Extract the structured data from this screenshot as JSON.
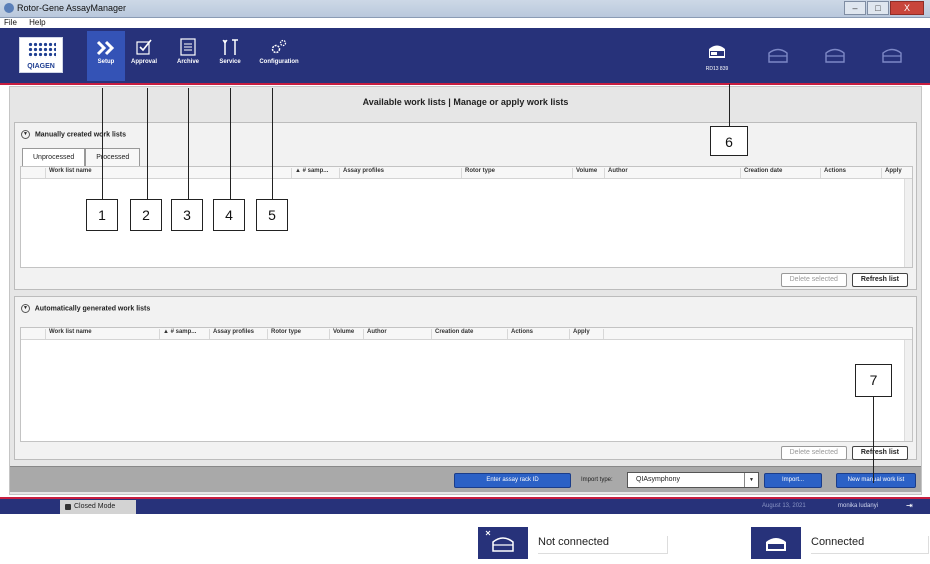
{
  "window": {
    "title": "Rotor-Gene AssayManager",
    "min": "–",
    "max": "□",
    "close": "X"
  },
  "menu": [
    "File",
    "Help"
  ],
  "logo_text": "QIAGEN",
  "nav": [
    {
      "label": "Setup",
      "icon": "setup-icon"
    },
    {
      "label": "Approval",
      "icon": "approval-icon"
    },
    {
      "label": "Archive",
      "icon": "archive-icon"
    },
    {
      "label": "Service",
      "icon": "service-icon"
    },
    {
      "label": "Configuration",
      "icon": "configuration-icon"
    }
  ],
  "instruments": [
    {
      "label": "RD13 839",
      "icon": "cycler-icon"
    }
  ],
  "main_title": "Available work lists | Manage or apply work lists",
  "panel1": {
    "title": "Manually created work lists",
    "tabs": [
      "Unprocessed",
      "Processed"
    ],
    "columns": [
      "Work list name",
      "▲ # samp...",
      "Assay profiles",
      "Rotor type",
      "Volume",
      "Author",
      "Creation date",
      "Actions",
      "Apply"
    ],
    "delete_label": "Delete selected",
    "refresh_label": "Refresh list"
  },
  "panel2": {
    "title": "Automatically generated work lists",
    "columns": [
      "Work list name",
      "▲ # samp...",
      "Assay profiles",
      "Rotor type",
      "Volume",
      "Author",
      "Creation date",
      "Actions",
      "Apply"
    ],
    "delete_label": "Delete selected",
    "refresh_label": "Refresh list"
  },
  "bottombar": {
    "enter_rack": "Enter assay rack ID",
    "import_type_label": "Import type:",
    "import_type_value": "QIAsymphony",
    "import_btn": "Import...",
    "new_list_btn": "New manual work list"
  },
  "status": {
    "mode": "Closed Mode",
    "date": "August 13, 2021",
    "user": "monika ludanyi"
  },
  "legend": [
    {
      "text": "Not connected",
      "icon": "cycler-not-connected-icon"
    },
    {
      "text": "Connected",
      "icon": "cycler-connected-icon"
    }
  ],
  "annotations": [
    "1",
    "2",
    "3",
    "4",
    "5",
    "6",
    "7"
  ]
}
